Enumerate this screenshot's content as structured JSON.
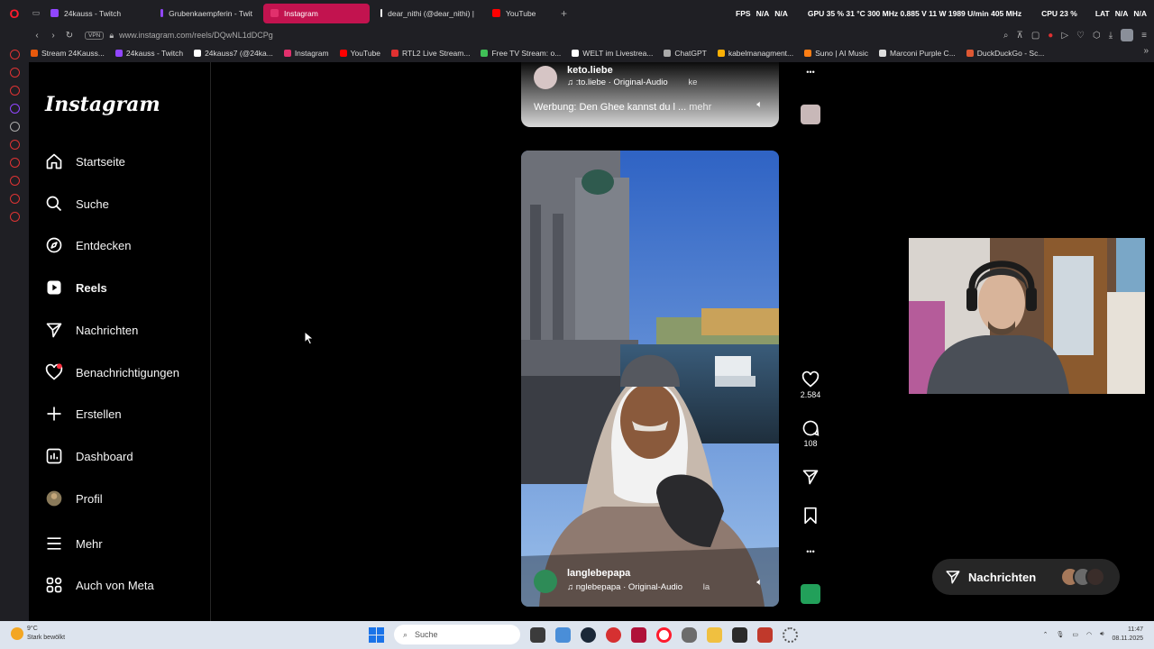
{
  "browser": {
    "tabs": [
      {
        "label": "24kauss - Twitch",
        "color": "#9146ff",
        "active": false
      },
      {
        "label": "Grubenkaempferin - Twit",
        "color": "#9146ff",
        "active": false
      },
      {
        "label": "Instagram",
        "color": "#e1306c",
        "active": true
      },
      {
        "label": "dear_nithi (@dear_nithi) |",
        "color": "#ffffff",
        "active": false
      },
      {
        "label": "YouTube",
        "color": "#ff0000",
        "active": false
      }
    ],
    "stats": {
      "fps_label": "FPS",
      "fps_value": "N/A",
      "fps_value2": "N/A",
      "gpu": "GPU 35 % 31 °C 300 MHz 0.885 V 11 W 1989 U/min 405 MHz",
      "cpu": "CPU 23 %",
      "lat_label": "LAT",
      "lat_value": "N/A",
      "lat_value2": "N/A"
    },
    "vpn_label": "VPN",
    "url": "www.instagram.com/reels/DQwNL1dDCPg",
    "bookmarks": [
      {
        "label": "Stream 24Kauss...",
        "color": "#e8590c"
      },
      {
        "label": "24kauss - Twitch",
        "color": "#9146ff"
      },
      {
        "label": "24kauss7 (@24ka...",
        "color": "#ffffff"
      },
      {
        "label": "Instagram",
        "color": "#e1306c"
      },
      {
        "label": "YouTube",
        "color": "#ff0000"
      },
      {
        "label": "RTL2 Live Stream...",
        "color": "#e03131"
      },
      {
        "label": "Free TV Stream: o...",
        "color": "#40c057"
      },
      {
        "label": "WELT im Livestrea...",
        "color": "#ffffff"
      },
      {
        "label": "ChatGPT",
        "color": "#aaaaaa"
      },
      {
        "label": "kabelmanagment...",
        "color": "#fab005"
      },
      {
        "label": "Suno | AI Music",
        "color": "#fd7e14"
      },
      {
        "label": "Marconi Purple C...",
        "color": "#dddddd"
      },
      {
        "label": "DuckDuckGo - Sc...",
        "color": "#de5833"
      }
    ]
  },
  "instagram": {
    "logo": "Instagram",
    "nav": [
      {
        "label": "Startseite",
        "icon": "home-icon"
      },
      {
        "label": "Suche",
        "icon": "search-icon"
      },
      {
        "label": "Entdecken",
        "icon": "explore-icon"
      },
      {
        "label": "Reels",
        "icon": "reels-icon",
        "active": true
      },
      {
        "label": "Nachrichten",
        "icon": "messages-icon"
      },
      {
        "label": "Benachrichtigungen",
        "icon": "heart-icon"
      },
      {
        "label": "Erstellen",
        "icon": "plus-icon"
      },
      {
        "label": "Dashboard",
        "icon": "dashboard-icon"
      },
      {
        "label": "Profil",
        "icon": "avatar-icon"
      },
      {
        "label": "Mehr",
        "icon": "menu-icon"
      },
      {
        "label": "Auch von Meta",
        "icon": "meta-icon"
      }
    ],
    "reel_prev": {
      "username": "keto.liebe",
      "audio": "♫  :to.liebe · Original-Audio",
      "audio_cut": "ke",
      "caption": "Werbung: Den Ghee kannst du l ...",
      "more": "mehr"
    },
    "reel_current": {
      "username": "langlebepapa",
      "audio": "♫  nglebepapa · Original-Audio",
      "audio_cut": "la",
      "likes": "2.584",
      "comments": "108"
    },
    "messages_pill": "Nachrichten"
  },
  "taskbar": {
    "temp": "9°C",
    "weather": "Stark bewölkt",
    "search_placeholder": "Suche",
    "time": "11:47",
    "date": "08.11.2025"
  }
}
